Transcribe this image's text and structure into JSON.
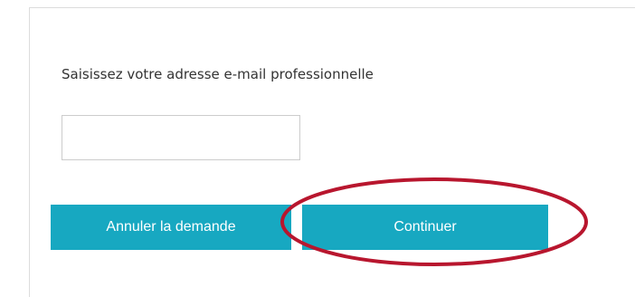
{
  "form": {
    "prompt_label": "Saisissez votre adresse e-mail professionnelle",
    "email_value": "",
    "email_placeholder": ""
  },
  "actions": {
    "cancel_label": "Annuler la demande",
    "continue_label": "Continuer"
  },
  "colors": {
    "button_bg": "#17a8c1",
    "highlight_ellipse": "#b8162e"
  }
}
